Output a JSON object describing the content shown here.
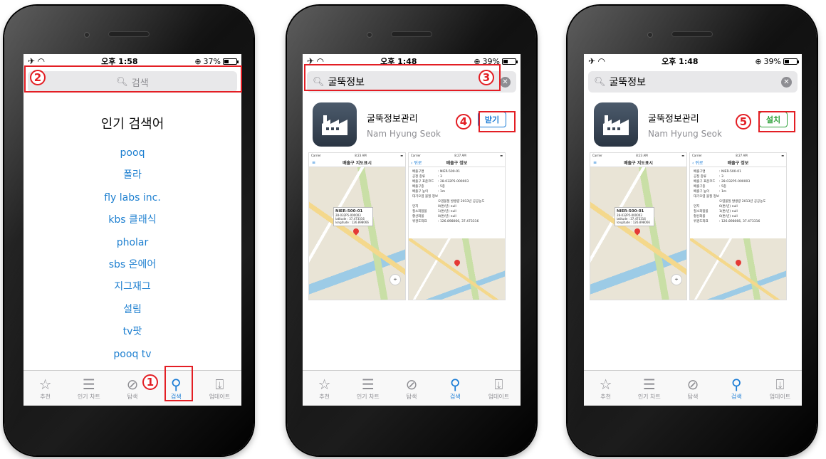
{
  "screens": [
    {
      "status": {
        "time": "오후 1:58",
        "battery": "37%",
        "battery_level": 0.37
      },
      "search": {
        "placeholder": "검색"
      },
      "popular": {
        "title": "인기 검색어",
        "items": [
          "pooq",
          "폴라",
          "fly labs inc.",
          "kbs 클래식",
          "pholar",
          "sbs 온에어",
          "지그재그",
          "설림",
          "tv팟",
          "pooq tv"
        ]
      }
    },
    {
      "status": {
        "time": "오후 1:48",
        "battery": "39%",
        "battery_level": 0.39
      },
      "search": {
        "query": "굴뚝정보"
      },
      "app": {
        "name": "굴뚝정보관리",
        "developer": "Nam Hyung Seok",
        "button": "받기"
      }
    },
    {
      "status": {
        "time": "오후 1:48",
        "battery": "39%",
        "battery_level": 0.39
      },
      "search": {
        "query": "굴뚝정보"
      },
      "app": {
        "name": "굴뚝정보관리",
        "developer": "Nam Hyung Seok",
        "button": "설치"
      }
    }
  ],
  "screenshots": {
    "map_screen": {
      "carrier": "Carrier",
      "time": "8:23 AM",
      "title": "배출구 지도표시",
      "card_title": "NIER-500-01",
      "card_lines": [
        "28-032P5-000003",
        "latitude : 37.473316",
        "longitude : 126.898066"
      ]
    },
    "detail_screen": {
      "carrier": "Carrier",
      "time": "8:27 AM",
      "back": "뒤로",
      "title": "배출구 정보",
      "rows": [
        [
          "배출구명",
          ": NIER-500-01"
        ],
        [
          "공정 종류",
          ": 3"
        ],
        [
          "배출구 표준코드",
          ": 28-032P5-000003"
        ],
        [
          "배출구종",
          ": 5종"
        ],
        [
          "배출구 높이",
          ": 1m"
        ],
        [
          "대기오염 물질 정보",
          ""
        ],
        [
          "",
          "오염물질 발생량    2013년 공공농도"
        ],
        [
          "먼지",
          "0(톤/년)    null"
        ],
        [
          "질소화합물",
          "1(톤/년)    null"
        ],
        [
          "황산화물",
          "0(톤/년)    null"
        ],
        [
          "위경도좌표",
          ": 126.898066, 37.473316"
        ]
      ]
    }
  },
  "tabbar": {
    "items": [
      {
        "label": "추천",
        "icon": "star-icon"
      },
      {
        "label": "인기 차트",
        "icon": "list-icon"
      },
      {
        "label": "탐색",
        "icon": "compass-icon"
      },
      {
        "label": "검색",
        "icon": "search-icon"
      },
      {
        "label": "업데이트",
        "icon": "download-icon"
      }
    ]
  },
  "annotations": [
    "1",
    "2",
    "3",
    "4",
    "5"
  ],
  "colors": {
    "accent": "#1a7cd6",
    "marker": "#e31e24",
    "install_green": "#2fa23b"
  }
}
